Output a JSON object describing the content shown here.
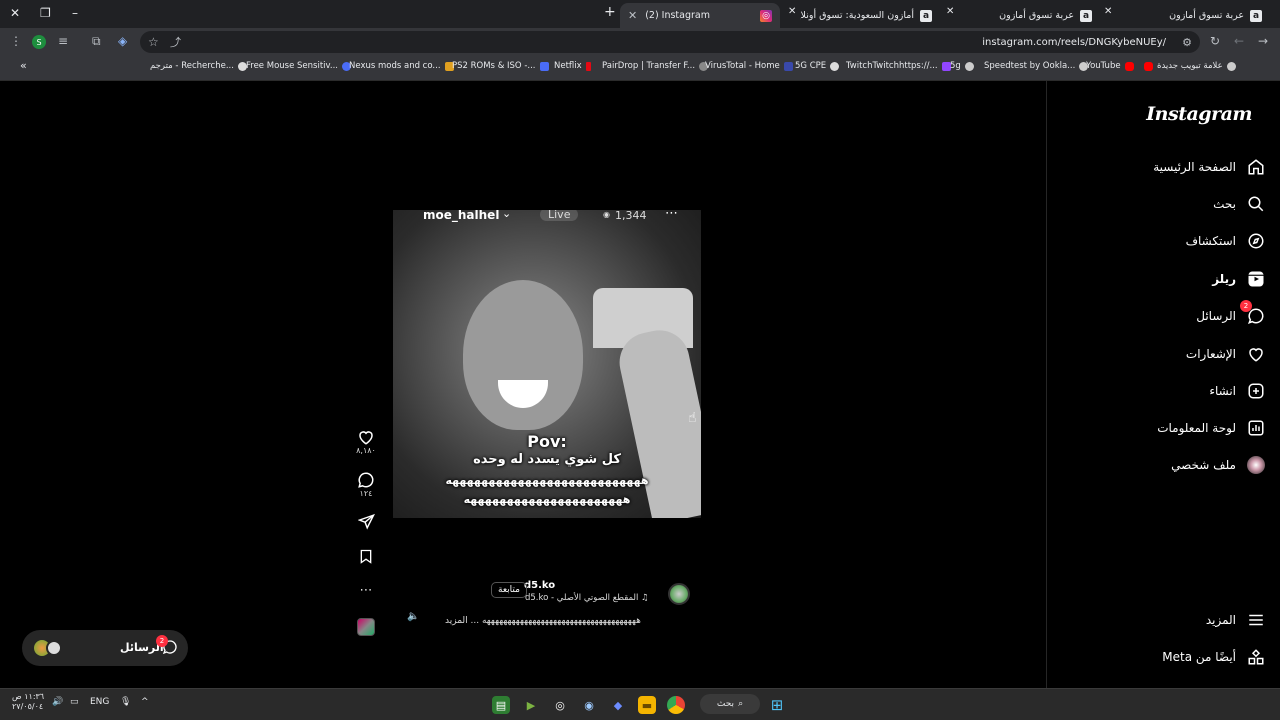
{
  "browser": {
    "tabs": [
      {
        "title": "عربة تسوق أمازون",
        "icon": "amazon-icon"
      },
      {
        "title": "عربة تسوق أمازون",
        "icon": "amazon-icon"
      },
      {
        "title": "أمازون السعودية: تسوق أونلاين |",
        "icon": "amazon-icon"
      },
      {
        "title": "(2) Instagram",
        "icon": "instagram-icon"
      }
    ],
    "new_tab": "+",
    "url": "instagram.com/reels/DNGKybeNUEy/",
    "bookmarks": [
      "علامة تبويب جديدة",
      "YouTube",
      "Speedtest by Ookla...",
      "5g",
      "TwitchTwitchhttps://...",
      "5G CPE",
      "VirusTotal - Home",
      "PairDrop | Transfer F...",
      "Netflix",
      "PS2 ROMs & ISO -...",
      "Nexus mods and co...",
      "Free Mouse Sensitiv...",
      "مترجم - Recherche..."
    ]
  },
  "sidebar": {
    "logo": "Instagram",
    "items": [
      {
        "label": "الصفحة الرئيسية",
        "icon": "home-icon"
      },
      {
        "label": "بحث",
        "icon": "search-icon"
      },
      {
        "label": "استكشاف",
        "icon": "compass-icon"
      },
      {
        "label": "ريلز",
        "icon": "reels-icon"
      },
      {
        "label": "الرسائل",
        "icon": "messenger-icon",
        "badge": "2"
      },
      {
        "label": "الإشعارات",
        "icon": "heart-icon"
      },
      {
        "label": "انشاء",
        "icon": "plus-square-icon"
      },
      {
        "label": "لوحة المعلومات",
        "icon": "dashboard-icon"
      },
      {
        "label": "ملف شخصي",
        "icon": "profile-avatar-icon"
      }
    ],
    "more": "المزيد",
    "meta": "أيضًا من Meta"
  },
  "reel": {
    "video_user": "moe_halhel",
    "live_label": "Live",
    "views": "1,344",
    "pov": "Pov:",
    "line1": "كل شوي يسدد له وحده",
    "line2": "هههههههههههههههههههههههههههه",
    "line3": "ههههههههههههههههههههههه",
    "username": "d5.ko",
    "follow": "متابعة",
    "audio": "المقطع الصوتي الأصلي - d5.ko",
    "caption": "هههههههههههههههههههههههههههههههههههههه ... المزيد"
  },
  "actions": {
    "likes": "٨,١٨٠",
    "comments": "١٢٤"
  },
  "messages_pill": {
    "label": "الرسائل",
    "badge": "2"
  },
  "taskbar": {
    "time": "١١:٣٦ ص",
    "date": "٢٧/٠٥/٠٤",
    "lang": "ENG",
    "search": "بحث"
  }
}
